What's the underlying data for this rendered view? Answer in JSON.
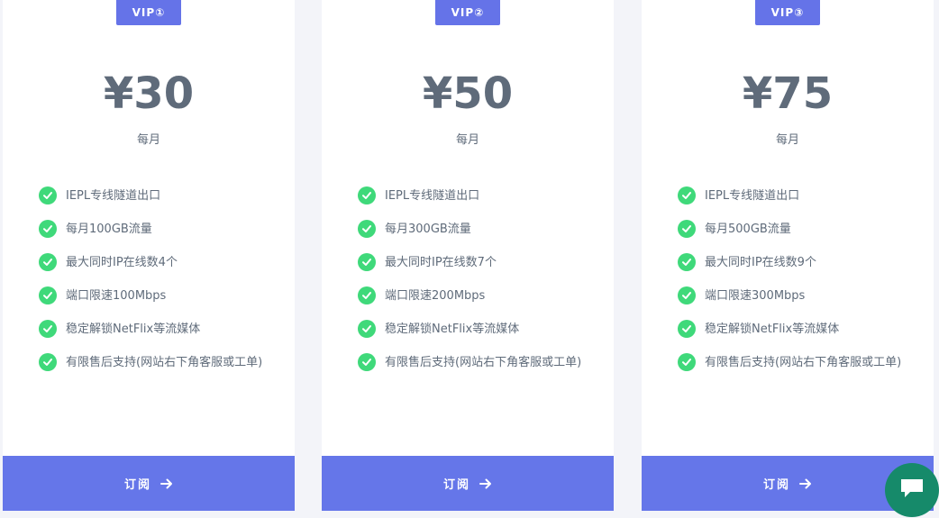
{
  "plans": [
    {
      "badge": "VIP①",
      "price": "¥30",
      "period": "每月",
      "features": [
        "IEPL专线隧道出口",
        "每月100GB流量",
        "最大同时IP在线数4个",
        "端口限速100Mbps",
        "稳定解锁NetFlix等流媒体",
        "有限售后支持(网站右下角客服或工单)"
      ],
      "button_label": "订阅"
    },
    {
      "badge": "VIP②",
      "price": "¥50",
      "period": "每月",
      "features": [
        "IEPL专线隧道出口",
        "每月300GB流量",
        "最大同时IP在线数7个",
        "端口限速200Mbps",
        "稳定解锁NetFlix等流媒体",
        "有限售后支持(网站右下角客服或工单)"
      ],
      "button_label": "订阅"
    },
    {
      "badge": "VIP③",
      "price": "¥75",
      "period": "每月",
      "features": [
        "IEPL专线隧道出口",
        "每月500GB流量",
        "最大同时IP在线数9个",
        "端口限速300Mbps",
        "稳定解锁NetFlix等流媒体",
        "有限售后支持(网站右下角客服或工单)"
      ],
      "button_label": "订阅"
    }
  ],
  "icons": {
    "feature": "check-circle-icon",
    "button": "arrow-right-icon",
    "chat": "chat-bubble-icon"
  },
  "colors": {
    "accent": "#6576e9",
    "check": "#3fd97a",
    "text": "#5f6b7a",
    "chat": "#168a6a",
    "background": "#f3f4f9"
  }
}
